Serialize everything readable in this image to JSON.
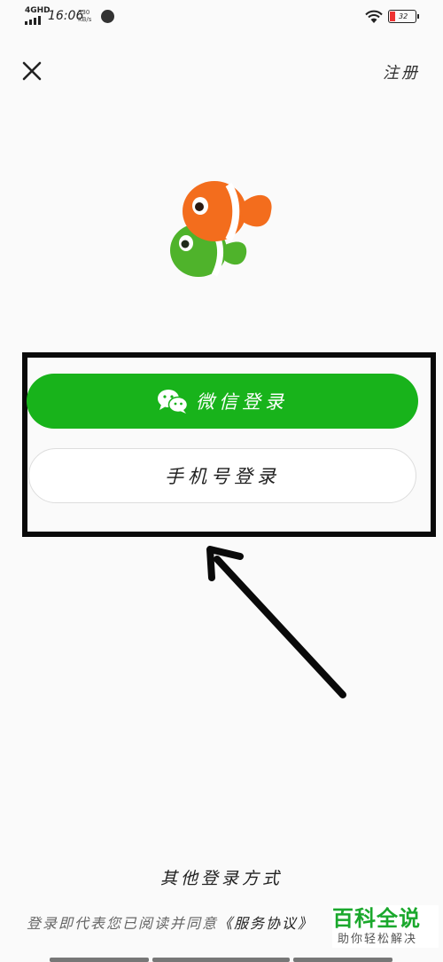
{
  "status_bar": {
    "network": "4GHD",
    "time": "16:06",
    "speed_value": "330",
    "speed_unit": "KB/s",
    "battery": "32"
  },
  "header": {
    "close_icon": "close-icon",
    "register_label": "注册"
  },
  "logo": {
    "icon": "clownfish-logo",
    "colors": {
      "orange": "#f36d1d",
      "green": "#4fb32b"
    }
  },
  "login": {
    "wechat_label": "微信登录",
    "wechat_icon": "wechat-icon",
    "phone_label": "手机号登录",
    "accent": "#18b31b"
  },
  "footer": {
    "other_methods": "其他登录方式",
    "agreement_prefix": "登录即代表您已阅读并同意",
    "agreement_link": "《服务协议》"
  },
  "watermark": {
    "title": "百科全说",
    "subtitle": "助你轻松解决"
  }
}
